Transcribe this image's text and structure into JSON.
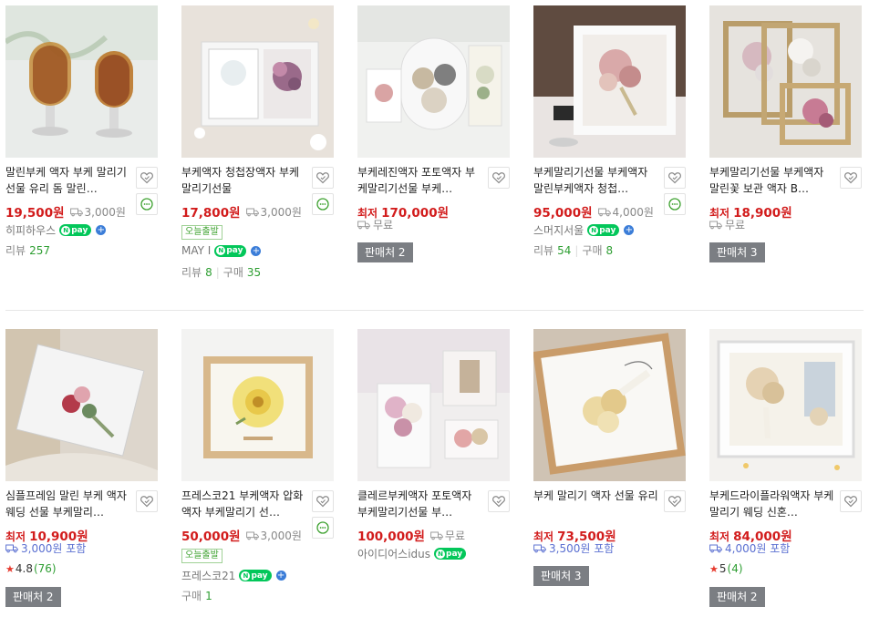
{
  "rows": [
    [
      {
        "title": "말린부케 액자 부케 말리기 선물 유리 돔 말린…",
        "price": "19,500원",
        "ship": "3,000원",
        "seller": "히피하우스",
        "npay": true,
        "npay_plus": true,
        "review_label": "리뷰",
        "review": "257",
        "chat": true
      },
      {
        "title": "부케액자 청첩장액자 부케말리기선물",
        "price": "17,800원",
        "ship": "3,000원",
        "today": "오늘출발",
        "seller": "MAY I",
        "npay": true,
        "npay_plus": true,
        "review_label": "리뷰",
        "review": "8",
        "buy_label": "구매",
        "buy": "35",
        "chat": true
      },
      {
        "title": "부케레진액자 포토액자 부케말리기선물 부케…",
        "lowest": "최저",
        "price": "170,000원",
        "shipline": "무료",
        "mall": "판매처 2"
      },
      {
        "title": "부케말리기선물 부케액자 말린부케액자 청첩…",
        "price": "95,000원",
        "ship": "4,000원",
        "seller": "스머지서울",
        "npay": true,
        "npay_plus": true,
        "review_label": "리뷰",
        "review": "54",
        "buy_label": "구매",
        "buy": "8",
        "chat": true
      },
      {
        "title": "부케말리기선물 부케액자 말린꽃 보관 액자 B…",
        "lowest": "최저",
        "price": "18,900원",
        "shipline": "무료",
        "mall": "판매처 3"
      }
    ],
    [
      {
        "title": "심플프레임 말린 부케 액자 웨딩 선물 부케말리…",
        "lowest": "최저",
        "price": "10,900원",
        "shipline": "3,000원 포함",
        "rating": "4.8",
        "rating_count": "(76)",
        "mall": "판매처 2"
      },
      {
        "title": "프레스코21 부케액자 압화액자 부케말리기 선…",
        "price": "50,000원",
        "ship": "3,000원",
        "today": "오늘출발",
        "seller": "프레스코21",
        "npay": true,
        "npay_plus": true,
        "buy_label": "구매",
        "buy": "1",
        "chat": true
      },
      {
        "title": "클레르부케액자 포토액자 부케말리기선물 부…",
        "price": "100,000원",
        "ship": "무료",
        "seller": "아이디어스idus",
        "npay": true,
        "npay_plus": false
      },
      {
        "title": "부케 말리기 액자 선물 유리",
        "lowest": "최저",
        "price": "73,500원",
        "shipline": "3,500원 포함",
        "mall": "판매처 3"
      },
      {
        "title": "부케드라이플라워액자 부케말리기 웨딩 신혼…",
        "lowest": "최저",
        "price": "84,000원",
        "shipline": "4,000원 포함",
        "rating": "5",
        "rating_count": "(4)",
        "mall": "판매처 2"
      }
    ]
  ],
  "npay_text": "pay",
  "icons": {
    "heart": "heart-icon",
    "chat": "chat-icon",
    "truck": "truck-icon",
    "star": "star-icon"
  },
  "colors": {
    "price": "#d21c1c",
    "npay": "#03c75a",
    "review_count": "#2e9e32",
    "mall_button": "#7b7e83",
    "shipping_included": "#5a6fd1"
  }
}
